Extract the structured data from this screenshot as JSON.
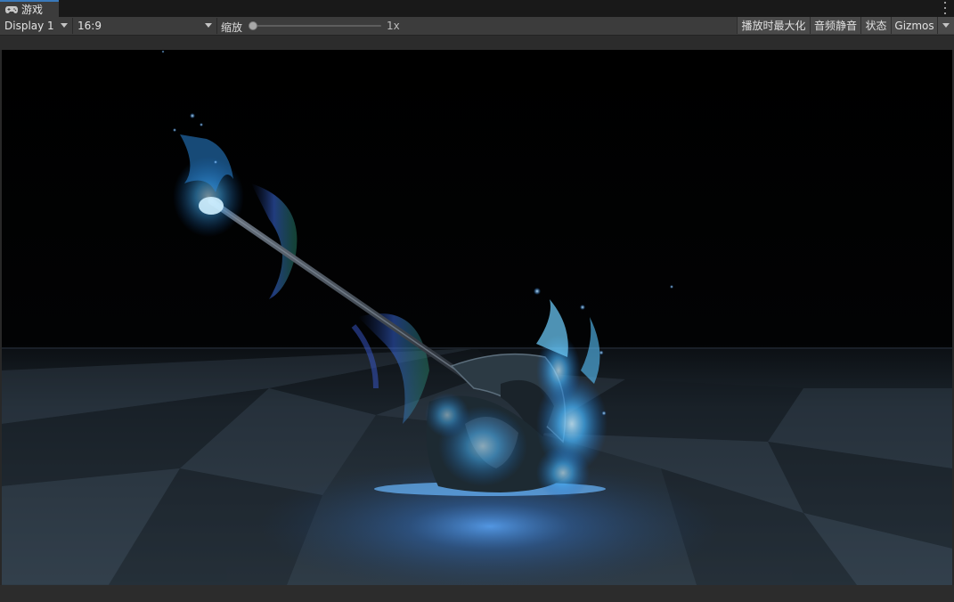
{
  "tabbar": {
    "tab_label": "游戏",
    "tab_icon": "gamepad-icon",
    "menu_icon": "kebab-menu-icon"
  },
  "toolbar": {
    "display": "Display 1",
    "aspect": "16:9",
    "zoom_label": "缩放",
    "zoom_value": "1x",
    "maximize_label": "播放时最大化",
    "mute_label": "音频静音",
    "stats_label": "状态",
    "gizmos_label": "Gizmos"
  },
  "colors": {
    "accent": "#3a79bb",
    "glow": "#3aa6ff",
    "floor": "#2a3640"
  }
}
